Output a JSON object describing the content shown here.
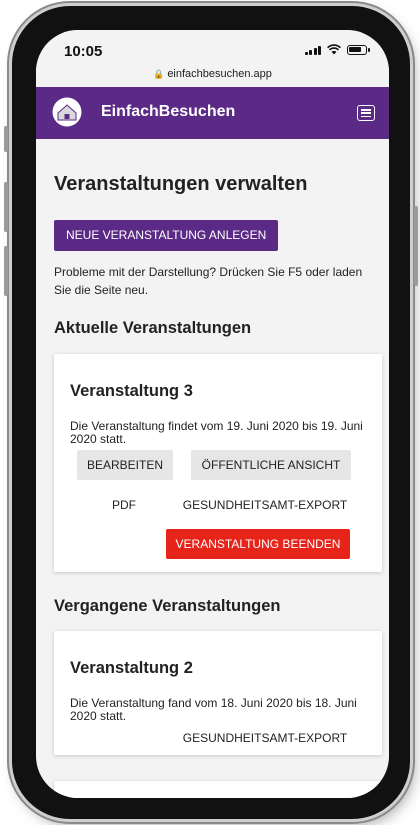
{
  "status": {
    "time": "10:05",
    "url": "einfachbesuchen.app"
  },
  "navbar": {
    "brand": "EinfachBesuchen"
  },
  "page": {
    "title": "Veranstaltungen verwalten",
    "new_button": "NEUE VERANSTALTUNG ANLEGEN",
    "hint": "Probleme mit der Darstellung? Drücken Sie F5 oder laden Sie die Seite neu.",
    "current_heading": "Aktuelle Veranstaltungen",
    "past_heading": "Vergangene Veranstaltungen"
  },
  "current_events": [
    {
      "title": "Veranstaltung 3",
      "description": "Die Veranstaltung findet vom 19. Juni 2020 bis 19. Juni 2020 statt.",
      "edit": "BEARBEITEN",
      "public_view": "ÖFFENTLICHE ANSICHT",
      "pdf": "PDF",
      "export": "GESUNDHEITSAMT-EXPORT",
      "end": "VERANSTALTUNG BEENDEN"
    }
  ],
  "past_events": [
    {
      "title": "Veranstaltung 2",
      "description": "Die Veranstaltung fand vom 18. Juni 2020 bis 18. Juni 2020 statt.",
      "export": "GESUNDHEITSAMT-EXPORT"
    }
  ],
  "colors": {
    "primary": "#5b2a86",
    "danger": "#e6241a",
    "background": "#f3f3f3"
  }
}
